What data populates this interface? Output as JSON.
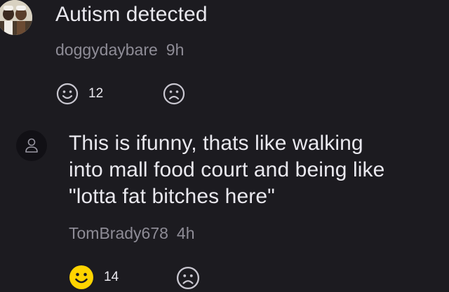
{
  "comments": [
    {
      "text": "Autism detected",
      "username": "doggydaybare",
      "time": "9h",
      "likes": "12",
      "liked": false
    },
    {
      "text_lines": [
        "This is ifunny, thats like walking",
        "into mall food court and being like",
        "\"lotta fat bitches here\""
      ],
      "username": "TomBrady678",
      "time": "4h",
      "likes": "14",
      "liked": true
    }
  ],
  "colors": {
    "background": "#1c1b20",
    "text": "#e9e8ee",
    "meta": "#8e8c96",
    "icon": "#c9c7d0",
    "smile_active": "#ffd400"
  }
}
